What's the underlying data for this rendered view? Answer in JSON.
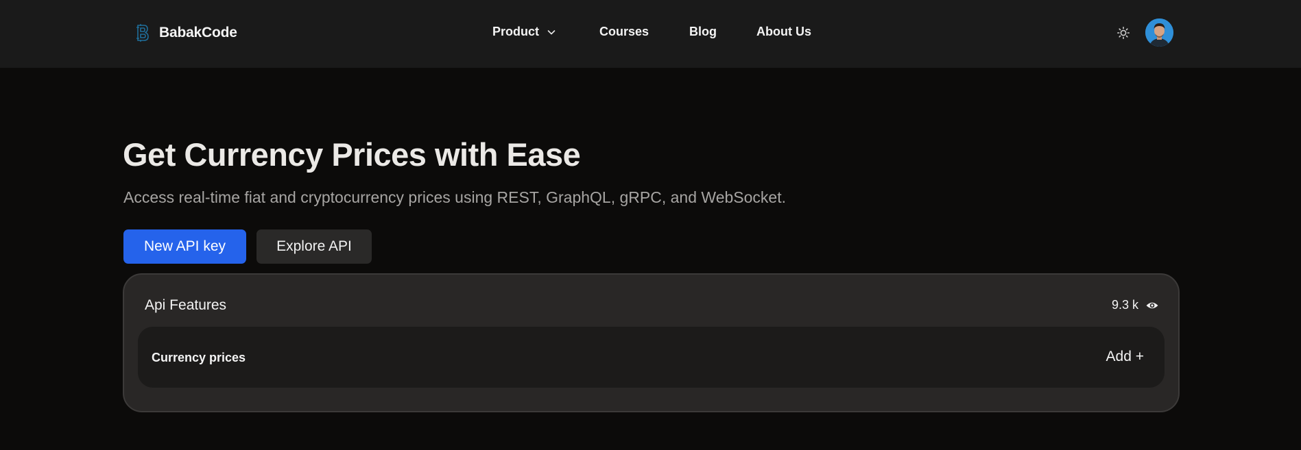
{
  "brand": {
    "name": "BabakCode",
    "logo_icon": "b-letter-logo-icon",
    "accent_color": "#1f6e9a"
  },
  "nav": {
    "items": [
      {
        "label": "Product",
        "has_dropdown": true,
        "icon": "chevron-down-icon"
      },
      {
        "label": "Courses"
      },
      {
        "label": "Blog"
      },
      {
        "label": "About Us"
      }
    ]
  },
  "header_actions": {
    "theme_icon": "sun-icon",
    "avatar_icon": "user-avatar"
  },
  "hero": {
    "title": "Get Currency Prices with Ease",
    "subtitle": "Access real-time fiat and cryptocurrency prices using REST, GraphQL, gRPC, and WebSocket.",
    "primary_button": "New API key",
    "secondary_button": "Explore API",
    "primary_color": "#2563eb"
  },
  "card": {
    "title": "Api Features",
    "views": "9.3 k",
    "views_icon": "eye-icon",
    "features": [
      {
        "name": "Currency prices",
        "action": "Add +"
      }
    ]
  }
}
